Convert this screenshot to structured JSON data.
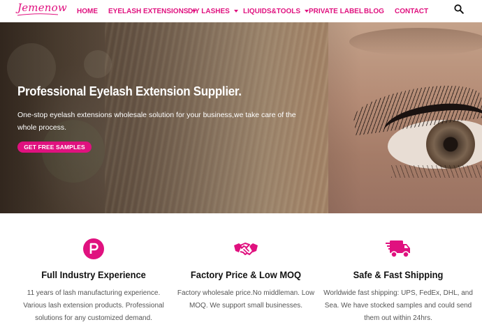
{
  "header": {
    "logo_text": "Jemenow",
    "nav": [
      {
        "label": "HOME",
        "has_dropdown": false
      },
      {
        "label": "EYELASH EXTENSIONS",
        "has_dropdown": true
      },
      {
        "label": "DIY LASHES",
        "has_dropdown": true
      },
      {
        "label": "LIQUIDS&TOOLS",
        "has_dropdown": true
      },
      {
        "label": "PRIVATE LABEL",
        "has_dropdown": false
      },
      {
        "label": "BLOG",
        "has_dropdown": false
      },
      {
        "label": "CONTACT",
        "has_dropdown": false
      }
    ],
    "search_icon": "search-icon"
  },
  "hero": {
    "title": "Professional Eyelash Extension Supplier.",
    "subtitle": "One-stop eyelash extensions wholesale solution for your business,we take care of the whole process.",
    "cta_label": "GET FREE SAMPLES"
  },
  "features": [
    {
      "icon": "p-circle-icon",
      "title": "Full Industry Experience",
      "text": "11 years of lash manufacturing experience. Various lash extension products. Professional solutions for any customized demand."
    },
    {
      "icon": "handshake-icon",
      "title": "Factory Price & Low MOQ",
      "text": "Factory wholesale price.No middleman. Low MOQ. We support small businesses."
    },
    {
      "icon": "truck-icon",
      "title": "Safe & Fast Shipping",
      "text": "Worldwide fast shipping: UPS, FedEx, DHL, and Sea. We have stocked samples and could send them out within 24hrs."
    }
  ],
  "colors": {
    "accent": "#e0117f",
    "heading": "#111111",
    "body_text": "#555555",
    "background": "#ffffff"
  }
}
